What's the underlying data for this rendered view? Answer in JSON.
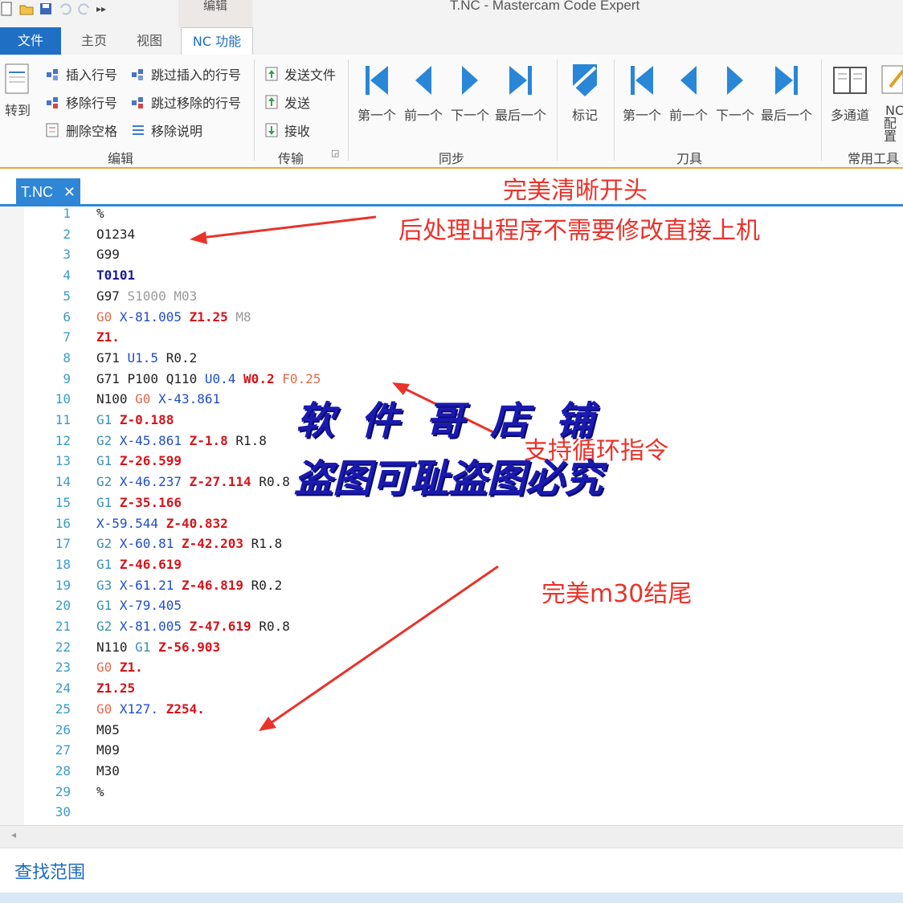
{
  "window": {
    "title": "T.NC - Mastercam Code Expert",
    "context_tab": "编辑"
  },
  "tabs": {
    "file": "文件",
    "home": "主页",
    "view": "视图",
    "nc": "NC 功能"
  },
  "ribbon": {
    "goto_label": "转到",
    "edit": {
      "insert_line_no": "插入行号",
      "skip_insert_line_no": "跳过插入的行号",
      "remove_line_no": "移除行号",
      "skip_remove_line_no": "跳过移除的行号",
      "delete_spaces": "删除空格",
      "remove_comments": "移除说明",
      "group_label": "编辑"
    },
    "transfer": {
      "send_file": "发送文件",
      "send": "发送",
      "receive": "接收",
      "group_label": "传输"
    },
    "sync": {
      "first": "第一个",
      "prev": "前一个",
      "next": "下一个",
      "last": "最后一个",
      "group_label": "同步"
    },
    "mark": {
      "label": "标记"
    },
    "tool": {
      "first": "第一个",
      "prev": "前一个",
      "next": "下一个",
      "last": "最后一个",
      "group_label": "刀具"
    },
    "common": {
      "multichannel": "多通道",
      "nc_config_1": "NC",
      "nc_config_2": "配置",
      "group_label": "常用工具"
    }
  },
  "document_tab": {
    "name": "T.NC",
    "close": "✕"
  },
  "code_lines": [
    {
      "n": "1",
      "tokens": [
        {
          "t": "%",
          "c": "black"
        }
      ]
    },
    {
      "n": "2",
      "tokens": [
        {
          "t": "O1234",
          "c": "black"
        }
      ]
    },
    {
      "n": "3",
      "tokens": [
        {
          "t": "G99",
          "c": "black"
        }
      ]
    },
    {
      "n": "4",
      "tokens": [
        {
          "t": "T0101",
          "c": "navy"
        }
      ]
    },
    {
      "n": "5",
      "tokens": [
        {
          "t": "G97 ",
          "c": "black"
        },
        {
          "t": "S1000 ",
          "c": "gray"
        },
        {
          "t": "M03",
          "c": "gray"
        }
      ]
    },
    {
      "n": "6",
      "tokens": [
        {
          "t": "G0 ",
          "c": "redl"
        },
        {
          "t": "X-81.005 ",
          "c": "blue"
        },
        {
          "t": "Z1.25 ",
          "c": "red"
        },
        {
          "t": "M8",
          "c": "gray"
        }
      ]
    },
    {
      "n": "7",
      "tokens": [
        {
          "t": "Z1.",
          "c": "red"
        }
      ]
    },
    {
      "n": "8",
      "tokens": [
        {
          "t": "G71 ",
          "c": "black"
        },
        {
          "t": "U1.5 ",
          "c": "blue"
        },
        {
          "t": "R0.2",
          "c": "black"
        }
      ]
    },
    {
      "n": "9",
      "tokens": [
        {
          "t": "G71 ",
          "c": "black"
        },
        {
          "t": "P100 ",
          "c": "black"
        },
        {
          "t": "Q110 ",
          "c": "black"
        },
        {
          "t": "U0.4 ",
          "c": "blue"
        },
        {
          "t": "W0.2 ",
          "c": "red"
        },
        {
          "t": "F0.25",
          "c": "redl"
        }
      ]
    },
    {
      "n": "10",
      "tokens": [
        {
          "t": "N100 ",
          "c": "black"
        },
        {
          "t": "G0 ",
          "c": "redl"
        },
        {
          "t": "X-43.861",
          "c": "blue"
        }
      ]
    },
    {
      "n": "11",
      "tokens": [
        {
          "t": "G1 ",
          "c": "teal"
        },
        {
          "t": "Z-0.188",
          "c": "red"
        }
      ]
    },
    {
      "n": "12",
      "tokens": [
        {
          "t": "G2 ",
          "c": "teal"
        },
        {
          "t": "X-45.861 ",
          "c": "blue"
        },
        {
          "t": "Z-1.8 ",
          "c": "red"
        },
        {
          "t": "R1.8",
          "c": "black"
        }
      ]
    },
    {
      "n": "13",
      "tokens": [
        {
          "t": "G1 ",
          "c": "teal"
        },
        {
          "t": "Z-26.599",
          "c": "red"
        }
      ]
    },
    {
      "n": "14",
      "tokens": [
        {
          "t": "G2 ",
          "c": "teal"
        },
        {
          "t": "X-46.237 ",
          "c": "blue"
        },
        {
          "t": "Z-27.114 ",
          "c": "red"
        },
        {
          "t": "R0.8",
          "c": "black"
        }
      ]
    },
    {
      "n": "15",
      "tokens": [
        {
          "t": "G1 ",
          "c": "teal"
        },
        {
          "t": "Z-35.166",
          "c": "red"
        }
      ]
    },
    {
      "n": "16",
      "tokens": [
        {
          "t": "X-59.544 ",
          "c": "blue"
        },
        {
          "t": "Z-40.832",
          "c": "red"
        }
      ]
    },
    {
      "n": "17",
      "tokens": [
        {
          "t": "G2 ",
          "c": "teal"
        },
        {
          "t": "X-60.81 ",
          "c": "blue"
        },
        {
          "t": "Z-42.203 ",
          "c": "red"
        },
        {
          "t": "R1.8",
          "c": "black"
        }
      ]
    },
    {
      "n": "18",
      "tokens": [
        {
          "t": "G1 ",
          "c": "teal"
        },
        {
          "t": "Z-46.619",
          "c": "red"
        }
      ]
    },
    {
      "n": "19",
      "tokens": [
        {
          "t": "G3 ",
          "c": "teal"
        },
        {
          "t": "X-61.21 ",
          "c": "blue"
        },
        {
          "t": "Z-46.819 ",
          "c": "red"
        },
        {
          "t": "R0.2",
          "c": "black"
        }
      ]
    },
    {
      "n": "20",
      "tokens": [
        {
          "t": "G1 ",
          "c": "teal"
        },
        {
          "t": "X-79.405",
          "c": "blue"
        }
      ]
    },
    {
      "n": "21",
      "tokens": [
        {
          "t": "G2 ",
          "c": "teal"
        },
        {
          "t": "X-81.005 ",
          "c": "blue"
        },
        {
          "t": "Z-47.619 ",
          "c": "red"
        },
        {
          "t": "R0.8",
          "c": "black"
        }
      ]
    },
    {
      "n": "22",
      "tokens": [
        {
          "t": "N110 ",
          "c": "black"
        },
        {
          "t": "G1 ",
          "c": "teal"
        },
        {
          "t": "Z-56.903",
          "c": "red"
        }
      ]
    },
    {
      "n": "23",
      "tokens": [
        {
          "t": "G0 ",
          "c": "redl"
        },
        {
          "t": "Z1.",
          "c": "red"
        }
      ]
    },
    {
      "n": "24",
      "tokens": [
        {
          "t": "Z1.25",
          "c": "red"
        }
      ]
    },
    {
      "n": "25",
      "tokens": [
        {
          "t": "G0 ",
          "c": "redl"
        },
        {
          "t": "X127. ",
          "c": "blue"
        },
        {
          "t": "Z254.",
          "c": "red"
        }
      ]
    },
    {
      "n": "26",
      "tokens": [
        {
          "t": "M05",
          "c": "black"
        }
      ]
    },
    {
      "n": "27",
      "tokens": [
        {
          "t": "M09",
          "c": "black"
        }
      ]
    },
    {
      "n": "28",
      "tokens": [
        {
          "t": "M30",
          "c": "black"
        }
      ]
    },
    {
      "n": "29",
      "tokens": [
        {
          "t": "%",
          "c": "black"
        }
      ]
    },
    {
      "n": "30",
      "tokens": []
    }
  ],
  "annotations": {
    "perfect_start": "完美清晰开头",
    "no_modify": "后处理出程序不需要修改直接上机",
    "supports_cycles": "支持循环指令",
    "perfect_end": "完美m30结尾"
  },
  "watermark": {
    "line1": "软 件 哥 店 铺",
    "line2": "盗图可耻盗图必究"
  },
  "find_bar": {
    "label": "查找范围"
  },
  "colors": {
    "accent": "#1f6fc4",
    "ribbon_border": "#f0a33a",
    "annotation": "#e8332b",
    "watermark": "#1a1ab0"
  }
}
